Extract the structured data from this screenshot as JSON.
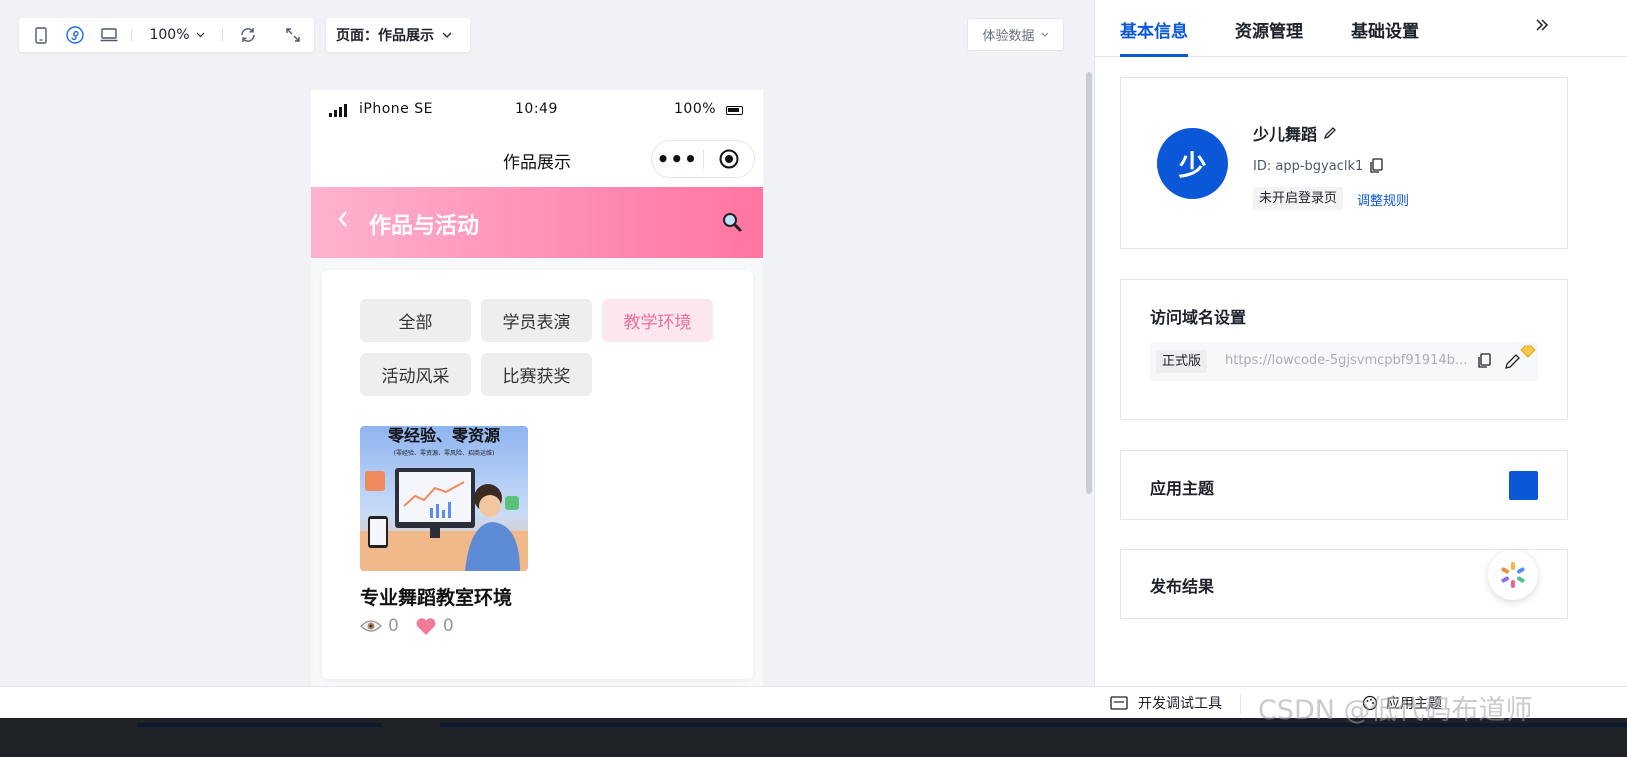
{
  "toolbar": {
    "icons": [
      "mobile-icon",
      "miniprogram-icon",
      "desktop-icon",
      "refresh-icon",
      "expand-icon"
    ],
    "zoom": "100%",
    "page_label": "页面：作品展示",
    "experience_data": "体验数据"
  },
  "phone": {
    "status": {
      "carrier": "iPhone SE",
      "time": "10:49",
      "battery": "100%"
    },
    "nav_title": "作品展示",
    "header_title": "作品与活动",
    "filters": [
      {
        "label": "全部",
        "active": false
      },
      {
        "label": "学员表演",
        "active": false
      },
      {
        "label": "教学环境",
        "active": true
      },
      {
        "label": "活动风采",
        "active": false
      },
      {
        "label": "比赛获奖",
        "active": false
      }
    ],
    "work": {
      "thumb_title": "零经验、零资源",
      "thumb_sub": "(零经验、零资源、零风险、招商运维)",
      "title": "专业舞蹈教室环境",
      "views": "0",
      "likes": "0"
    }
  },
  "panel": {
    "tabs": [
      "基本信息",
      "资源管理",
      "基础设置"
    ],
    "active_tab": 0,
    "app": {
      "avatar_char": "少",
      "name": "少儿舞蹈",
      "id": "ID: app-bgyaclk1",
      "login_tag": "未开启登录页",
      "adjust_link": "调整规则"
    },
    "domain": {
      "title": "访问域名设置",
      "version_tag": "正式版",
      "url": "https://lowcode-5gjsvmcpbf91914b..."
    },
    "theme": {
      "title": "应用主题",
      "color": "#0a58d8"
    },
    "publish": {
      "title": "发布结果"
    }
  },
  "bottom": {
    "devtools": "开发调试工具",
    "theme_button": "应用主题",
    "watermark": "CSDN @低代码布道师"
  },
  "colors": {
    "accent": "#0a58d8",
    "pink_active": "#ef6f9b"
  }
}
